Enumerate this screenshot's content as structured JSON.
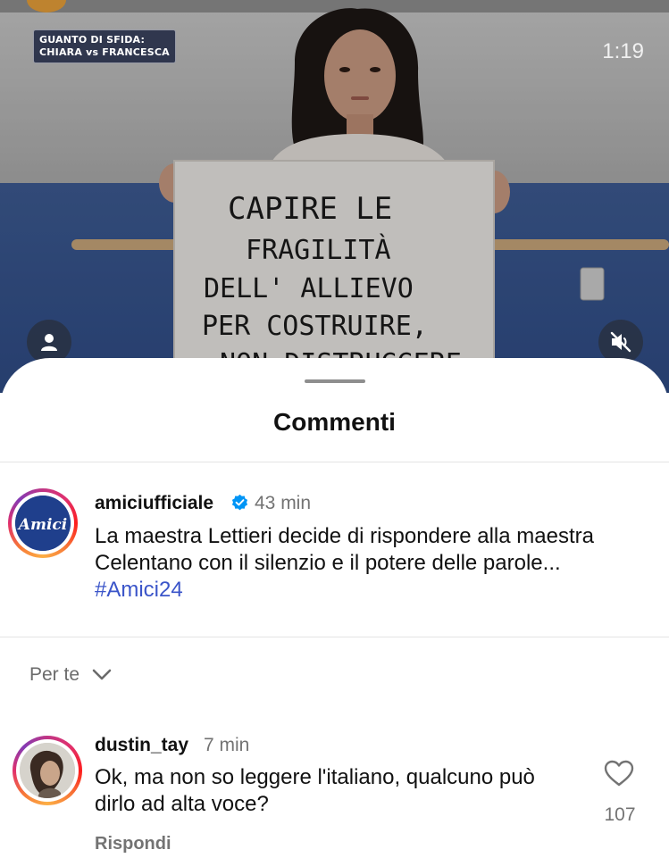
{
  "video": {
    "badge_line1": "GUANTO DI SFIDA:",
    "badge_line2": "CHIARA vs FRANCESCA",
    "time": "1:19",
    "sign_lines": [
      "CAPIRE LE",
      "FRAGILITÀ",
      "DELL' ALLIEVO",
      "PER COSTRUIRE,",
      "NON DISTRUGGERE"
    ],
    "profile_icon": "person-icon",
    "mute_icon": "speaker-muted-icon"
  },
  "sheet": {
    "title": "Commenti"
  },
  "caption": {
    "username": "amiciufficiale",
    "verified_icon": "verified-badge-icon",
    "time": "43 min",
    "text_plain": "La maestra Lettieri decide di rispondere alla maestra Celentano con il silenzio e il potere delle parole... ",
    "hashtag": "#Amici24",
    "logo_text": "Amici"
  },
  "sort": {
    "label": "Per te",
    "icon": "chevron-down-icon"
  },
  "comments": [
    {
      "username": "dustin_tay",
      "time": "7 min",
      "text": "Ok, ma non so leggere l'italiano, qualcuno può dirlo ad alta voce?",
      "likes": "107",
      "reply_label": "Rispondi",
      "like_icon": "heart-icon"
    }
  ],
  "colors": {
    "hashtag": "#3b55c9",
    "verified": "#0095f6",
    "secondary_text": "#737373"
  }
}
